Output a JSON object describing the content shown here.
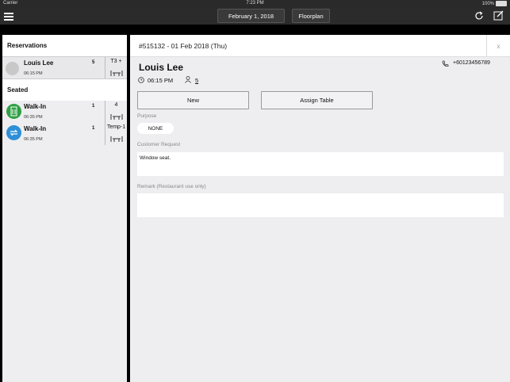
{
  "status_bar": {
    "carrier": "Carrier",
    "time": "7:23 PM",
    "battery": "100%"
  },
  "top_bar": {
    "date": "February 1, 2018",
    "floorplan_label": "Floorplan"
  },
  "sidebar": {
    "reservations_title": "Reservations",
    "reservations": [
      {
        "name": "Louis Lee",
        "time": "06:15 PM",
        "pax": "5",
        "table": "T3 +"
      }
    ],
    "seated_title": "Seated",
    "seated": [
      {
        "name": "Walk-In",
        "time": "06:35 PM",
        "pax": "1",
        "table": "4"
      },
      {
        "name": "Walk-In",
        "time": "06:35 PM",
        "pax": "1",
        "table": "Temp-1"
      }
    ]
  },
  "detail": {
    "reservation_id": "#515132 - 01 Feb 2018 (Thu)",
    "close_label": "x",
    "guest_name": "Louis Lee",
    "phone": "+60123456789",
    "time": "06:15 PM",
    "pax": "5",
    "new_button": "New",
    "assign_button": "Assign Table",
    "purpose_label": "Purpose",
    "purpose_value": "NONE",
    "customer_request_label": "Customer Request",
    "customer_request_value": "Window seat.",
    "remark_label": "Remark (Restaurant use only)",
    "remark_value": ""
  },
  "colors": {
    "topbar": "#2b2b2b",
    "walkin_green": "#2ea043",
    "walkin_blue": "#2d8fd8"
  }
}
